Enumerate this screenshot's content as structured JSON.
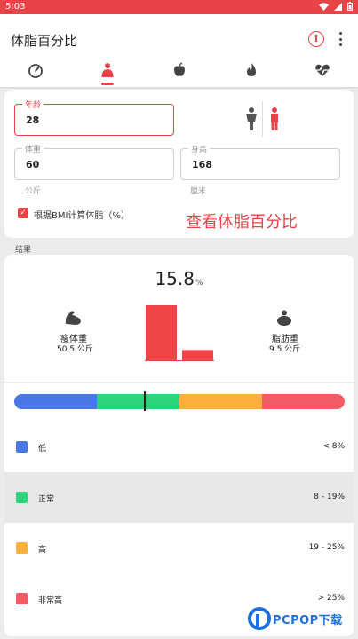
{
  "status_bar": {
    "time": "5:03"
  },
  "app_bar": {
    "title": "体脂百分比"
  },
  "tabs": [
    {
      "icon": "gauge-icon",
      "active": false
    },
    {
      "icon": "body-icon",
      "active": true
    },
    {
      "icon": "apple-icon",
      "active": false
    },
    {
      "icon": "flame-icon",
      "active": false
    },
    {
      "icon": "heartbeat-icon",
      "active": false
    }
  ],
  "form": {
    "age": {
      "label": "年龄",
      "value": "28"
    },
    "weight": {
      "label": "体重",
      "value": "60",
      "unit": "公斤"
    },
    "height": {
      "label": "身高",
      "value": "168",
      "unit": "厘米"
    },
    "bmi_checkbox": {
      "label": "根据BMI计算体脂（%）",
      "checked": true
    },
    "overlay_text": "查看体脂百分比",
    "gender_selected": "female"
  },
  "results": {
    "section_label": "结果",
    "percentage": "15.8",
    "percent_symbol": "%",
    "lean": {
      "label": "瘦体重",
      "value": "50.5 公斤",
      "kg": 50.5
    },
    "fat": {
      "label": "脂肪重",
      "value": "9.5 公斤",
      "kg": 9.5
    },
    "scale_marker_fraction": 0.396
  },
  "legend": [
    {
      "name": "低",
      "range": "< 8%",
      "color": "#4a77e6",
      "highlight": false
    },
    {
      "name": "正常",
      "range": "8 - 19%",
      "color": "#2ed47c",
      "highlight": true
    },
    {
      "name": "高",
      "range": "19 - 25%",
      "color": "#fbb03b",
      "highlight": false
    },
    {
      "name": "非常高",
      "range": "> 25%",
      "color": "#f35c64",
      "highlight": false
    }
  ],
  "colors": {
    "accent": "#e84448",
    "bar": "#ef4549",
    "male": "#555555",
    "female": "#e84448"
  },
  "watermark": {
    "text": "PCPOP下载"
  }
}
